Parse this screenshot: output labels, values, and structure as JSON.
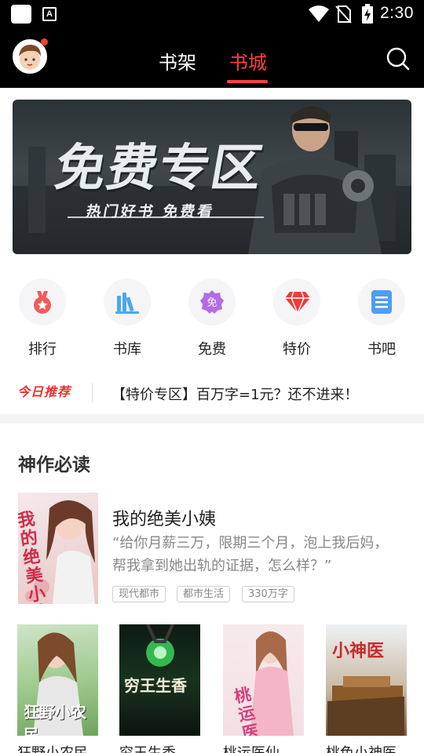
{
  "status_bar": {
    "time": "2:30",
    "notification_icon": "a-icon",
    "indicator_icons": [
      "wifi-icon",
      "no-sim-icon",
      "battery-charging-icon"
    ]
  },
  "header": {
    "tabs": [
      {
        "label": "书架",
        "active": false
      },
      {
        "label": "书城",
        "active": true
      }
    ],
    "active_color": "#ff4040",
    "has_notification_dot": true
  },
  "banner": {
    "title": "免费专区",
    "subtitle": "热门好书 免费看"
  },
  "categories": [
    {
      "label": "排行",
      "icon": "medal-icon",
      "color": "#f25b5b"
    },
    {
      "label": "书库",
      "icon": "books-icon",
      "color": "#4aa8f0"
    },
    {
      "label": "免费",
      "icon": "free-badge-icon",
      "icon_text": "免",
      "color": "#b56be6"
    },
    {
      "label": "特价",
      "icon": "diamond-icon",
      "color": "#ef3b3b"
    },
    {
      "label": "书吧",
      "icon": "document-icon",
      "color": "#4f9df5"
    }
  ],
  "recommend": {
    "badge": "今日推荐",
    "text": "【特价专区】百万字=1元？还不进来！"
  },
  "section": {
    "title": "神作必读"
  },
  "featured_book": {
    "title": "我的绝美小姨",
    "description": "“给你月薪三万，限期三个月，泡上我后妈，帮我拿到她出轨的证据，怎么样？”",
    "cover_text": "我的绝美小姨",
    "tags": [
      "现代都市",
      "都市生活",
      "330万字"
    ]
  },
  "books": [
    {
      "title": "狂野小农民",
      "cover_text": "狂野小农民"
    },
    {
      "title": "穷王生香",
      "cover_text": "穷王生香"
    },
    {
      "title": "桃运医仙",
      "cover_text": "桃运医仙"
    },
    {
      "title": "桃色小神医",
      "cover_text": "小神医"
    }
  ]
}
